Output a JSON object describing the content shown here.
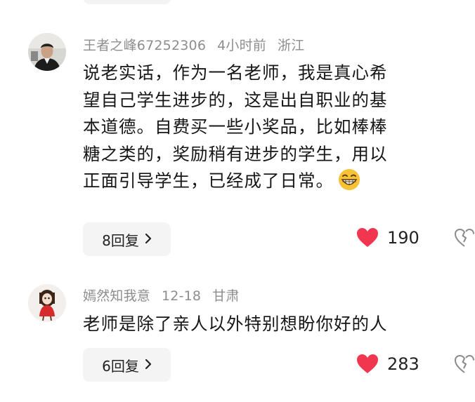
{
  "comments": [
    {
      "username": "王者之峰67252306",
      "time": "4小时前",
      "location": "浙江",
      "lines": [
        "说老实话，作为一名老师，我是真心希",
        "望自己学生进步的，这是出自职业的基",
        "本道德。自费买一些小奖品，比如棒棒",
        "糖之类的，奖励稍有进步的学生，用以",
        "正面引导学生，已经成了日常。"
      ],
      "emoji": "grinning-face-emoji",
      "replies_label": "8回复",
      "likes": "190"
    },
    {
      "username": "嫣然知我意",
      "time": "12-18",
      "location": "甘肃",
      "lines": [
        "老师是除了亲人以外特别想盼你好的人"
      ],
      "replies_label": "6回复",
      "likes": "283"
    }
  ],
  "colors": {
    "heart": "#f0374f",
    "meta_text": "#8d8d8d",
    "body_text": "#161616",
    "reply_bg": "#f4f4f4"
  },
  "icons": {
    "like": "heart-icon",
    "dislike": "broken-heart-icon",
    "reply_chevron": "chevron-right-icon"
  }
}
